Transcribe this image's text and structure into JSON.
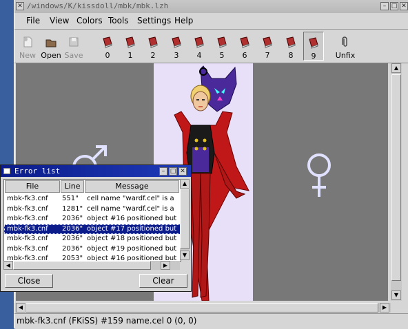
{
  "window": {
    "title": "/windows/K/kissdoll/mbk/mbk.lzh"
  },
  "menu": [
    "File",
    "View",
    "Colors",
    "Tools",
    "Settings",
    "Help"
  ],
  "toolbar": {
    "new": "New",
    "open": "Open",
    "save": "Save",
    "sets": [
      "0",
      "1",
      "2",
      "3",
      "4",
      "5",
      "6",
      "7",
      "8",
      "9"
    ],
    "active_set": "9",
    "unfix": "Unfix"
  },
  "status": {
    "text": "mbk-fk3.cnf (FKiSS) #159 name.cel 0 (0, 0)"
  },
  "error_list": {
    "title": "Error list",
    "headers": {
      "file": "File",
      "line": "Line",
      "message": "Message"
    },
    "rows": [
      {
        "file": "mbk-fk3.cnf",
        "line": "551\"",
        "message": "cell name \"wardf.cel\" is a"
      },
      {
        "file": "mbk-fk3.cnf",
        "line": "1281\"",
        "message": "cell name \"wardf.cel\" is a"
      },
      {
        "file": "mbk-fk3.cnf",
        "line": "2036\"",
        "message": "object #16 positioned but"
      },
      {
        "file": "mbk-fk3.cnf",
        "line": "2036\"",
        "message": "object #17 positioned but"
      },
      {
        "file": "mbk-fk3.cnf",
        "line": "2036\"",
        "message": "object #18 positioned but"
      },
      {
        "file": "mbk-fk3.cnf",
        "line": "2036\"",
        "message": "object #19 positioned but"
      },
      {
        "file": "mbk-fk3.cnf",
        "line": "2053\"",
        "message": "object #16 positioned but"
      }
    ],
    "selected_row": 3,
    "close": "Close",
    "clear": "Clear"
  },
  "colors": {
    "selection": "#0c1c8a",
    "paper": "#e8e0f8",
    "canvas": "#787878"
  }
}
